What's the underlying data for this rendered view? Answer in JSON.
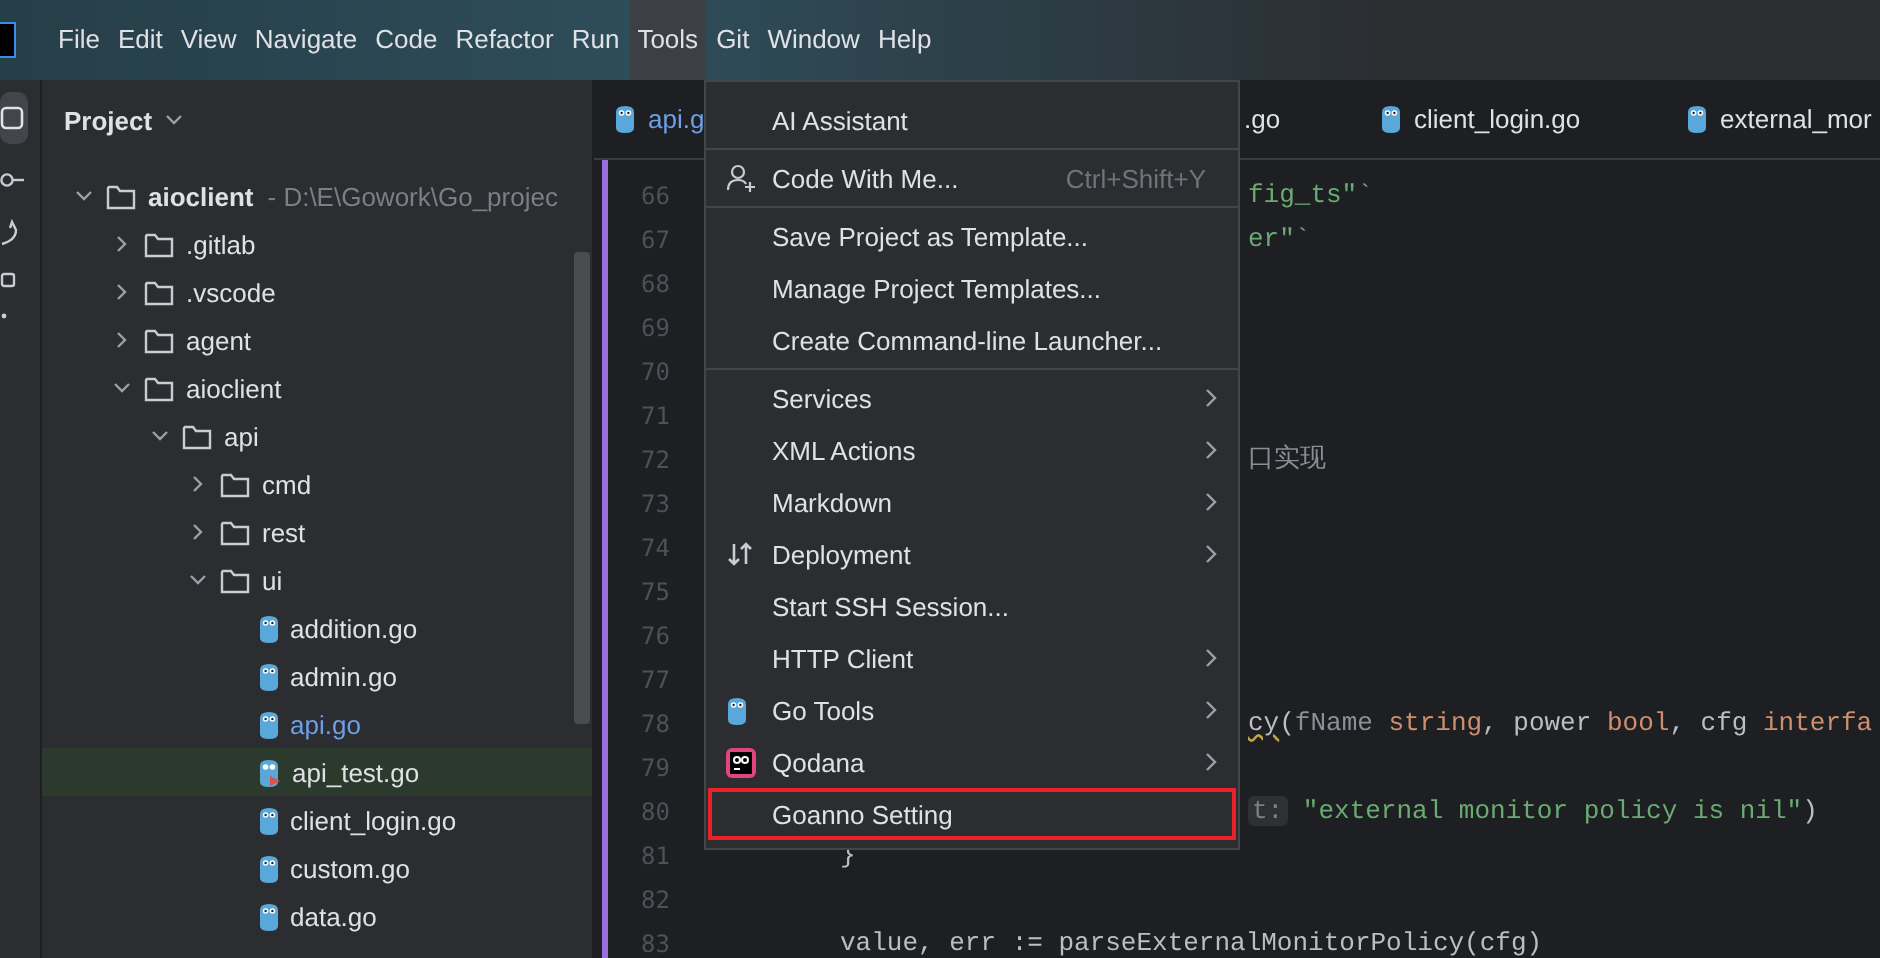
{
  "menubar": [
    {
      "label": "File",
      "selected": false
    },
    {
      "label": "Edit",
      "selected": false
    },
    {
      "label": "View",
      "selected": false
    },
    {
      "label": "Navigate",
      "selected": false
    },
    {
      "label": "Code",
      "selected": false
    },
    {
      "label": "Refactor",
      "selected": false
    },
    {
      "label": "Run",
      "selected": false
    },
    {
      "label": "Tools",
      "selected": true
    },
    {
      "label": "Git",
      "selected": false
    },
    {
      "label": "Window",
      "selected": false
    },
    {
      "label": "Help",
      "selected": false
    }
  ],
  "project_panel": {
    "title": "Project",
    "tree": [
      {
        "label": "aioclient",
        "kind": "root",
        "path": "- D:\\E\\Gowork\\Go_projec",
        "expanded": true,
        "selected": false,
        "children": [
          {
            "label": ".gitlab",
            "kind": "folder",
            "expanded": false,
            "selected": false,
            "modified": false
          },
          {
            "label": ".vscode",
            "kind": "folder",
            "expanded": false,
            "selected": false,
            "modified": false
          },
          {
            "label": "agent",
            "kind": "folder",
            "expanded": false,
            "selected": false,
            "modified": false
          },
          {
            "label": "aioclient",
            "kind": "folder",
            "expanded": true,
            "selected": false,
            "modified": false,
            "children": [
              {
                "label": "api",
                "kind": "folder",
                "expanded": true,
                "selected": false,
                "modified": false,
                "children": [
                  {
                    "label": "cmd",
                    "kind": "folder",
                    "expanded": false,
                    "selected": false,
                    "modified": false
                  },
                  {
                    "label": "rest",
                    "kind": "folder",
                    "expanded": false,
                    "selected": false,
                    "modified": false
                  },
                  {
                    "label": "ui",
                    "kind": "folder",
                    "expanded": true,
                    "selected": false,
                    "modified": false,
                    "children": [
                      {
                        "label": "addition.go",
                        "kind": "file",
                        "selected": false,
                        "modified": false
                      },
                      {
                        "label": "admin.go",
                        "kind": "file",
                        "selected": false,
                        "modified": false
                      },
                      {
                        "label": "api.go",
                        "kind": "file",
                        "selected": false,
                        "modified": true
                      },
                      {
                        "label": "api_test.go",
                        "kind": "test-file",
                        "selected": true,
                        "modified": false
                      },
                      {
                        "label": "client_login.go",
                        "kind": "file",
                        "selected": false,
                        "modified": false
                      },
                      {
                        "label": "custom.go",
                        "kind": "file",
                        "selected": false,
                        "modified": false
                      },
                      {
                        "label": "data.go",
                        "kind": "file",
                        "selected": false,
                        "modified": false
                      }
                    ]
                  }
                ]
              }
            ]
          }
        ]
      }
    ]
  },
  "editor": {
    "tabs": [
      {
        "label": "api.g",
        "partial": false,
        "modified": true
      },
      {
        "label": ".go",
        "partial": true,
        "modified": false
      },
      {
        "label": "client_login.go",
        "partial": false,
        "modified": false
      },
      {
        "label": "external_mor",
        "partial": false,
        "modified": false
      }
    ],
    "lines": [
      {
        "number": "66",
        "segments": [
          {
            "text": "fig_ts\"`",
            "kind": "string"
          }
        ]
      },
      {
        "number": "67",
        "segments": [
          {
            "text": "er\"`",
            "kind": "string"
          }
        ]
      },
      {
        "number": "68"
      },
      {
        "number": "69"
      },
      {
        "number": "70"
      },
      {
        "number": "71"
      },
      {
        "number": "72",
        "segments": [
          {
            "text": "口实现",
            "kind": "comment"
          }
        ]
      },
      {
        "number": "73"
      },
      {
        "number": "74"
      },
      {
        "number": "75"
      },
      {
        "number": "76"
      },
      {
        "number": "77"
      },
      {
        "number": "78",
        "segments": [
          {
            "text": "cy",
            "kind": "function"
          },
          {
            "text": "(",
            "kind": "plain"
          },
          {
            "text": "fName",
            "kind": "param"
          },
          {
            "text": " string",
            "kind": "keyword"
          },
          {
            "text": ", power ",
            "kind": "plain"
          },
          {
            "text": "bool",
            "kind": "keyword"
          },
          {
            "text": ", cfg ",
            "kind": "plain"
          },
          {
            "text": "interfa",
            "kind": "keyword"
          }
        ]
      },
      {
        "number": "79"
      },
      {
        "number": "80",
        "segments": [
          {
            "text": "t:",
            "kind": "hint"
          },
          {
            "text": " \"external monitor policy is nil\"",
            "kind": "string"
          },
          {
            "text": ")",
            "kind": "plain"
          }
        ]
      },
      {
        "number": "81",
        "segments": [
          {
            "text": "}",
            "kind": "plain"
          }
        ]
      },
      {
        "number": "82"
      },
      {
        "number": "83",
        "segments": [
          {
            "text": "value, err := parseExternalMonitorPolicy(cfg)",
            "kind": "plain"
          }
        ]
      }
    ]
  },
  "tools_menu": [
    {
      "kind": "item",
      "label": "AI Assistant",
      "submenu": false,
      "annotated": false
    },
    {
      "kind": "separator"
    },
    {
      "kind": "item",
      "label": "Code With Me...",
      "shortcut": "Ctrl+Shift+Y",
      "submenu": false,
      "annotated": false
    },
    {
      "kind": "separator"
    },
    {
      "kind": "item",
      "label": "Save Project as Template...",
      "submenu": false,
      "annotated": false
    },
    {
      "kind": "item",
      "label": "Manage Project Templates...",
      "submenu": false,
      "annotated": false
    },
    {
      "kind": "item",
      "label": "Create Command-line Launcher...",
      "submenu": false,
      "annotated": false
    },
    {
      "kind": "separator"
    },
    {
      "kind": "item",
      "label": "Services",
      "submenu": true,
      "annotated": false
    },
    {
      "kind": "item",
      "label": "XML Actions",
      "submenu": true,
      "annotated": false
    },
    {
      "kind": "item",
      "label": "Markdown",
      "submenu": true,
      "annotated": false
    },
    {
      "kind": "item",
      "label": "Deployment",
      "submenu": true,
      "annotated": false
    },
    {
      "kind": "item",
      "label": "Start SSH Session...",
      "submenu": false,
      "annotated": false
    },
    {
      "kind": "item",
      "label": "HTTP Client",
      "submenu": true,
      "annotated": false
    },
    {
      "kind": "item",
      "label": "Go Tools",
      "submenu": true,
      "annotated": false
    },
    {
      "kind": "item",
      "label": "Qodana",
      "submenu": true,
      "annotated": false
    },
    {
      "kind": "item",
      "label": "Goanno Setting",
      "submenu": false,
      "annotated": true
    }
  ]
}
